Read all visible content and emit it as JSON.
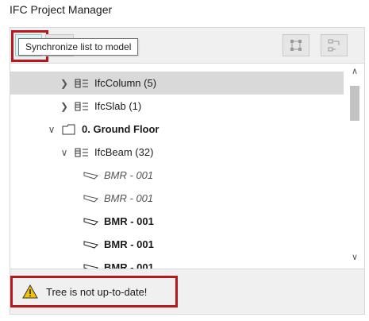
{
  "window": {
    "title": "IFC Project Manager"
  },
  "toolbar": {
    "sync_tooltip": "Synchronize list to model"
  },
  "tree": {
    "rows": [
      {
        "label": "IfcColumn (5)",
        "expand": ">",
        "icon": "ifc-entity-icon",
        "style": "normal"
      },
      {
        "label": "IfcSlab (1)",
        "expand": ">",
        "icon": "ifc-entity-icon",
        "style": "normal"
      },
      {
        "label": "0. Ground Floor",
        "expand": "v",
        "icon": "storey-icon",
        "style": "bold"
      },
      {
        "label": "IfcBeam (32)",
        "expand": "v",
        "icon": "ifc-entity-icon",
        "style": "normal"
      },
      {
        "label": "BMR - 001",
        "icon": "beam-icon",
        "style": "italic"
      },
      {
        "label": "BMR - 001",
        "icon": "beam-icon",
        "style": "italic"
      },
      {
        "label": "BMR - 001",
        "icon": "beam-icon",
        "style": "bold"
      },
      {
        "label": "BMR - 001",
        "icon": "beam-icon",
        "style": "bold"
      },
      {
        "label": "BMR - 001",
        "icon": "beam-icon",
        "style": "bold"
      }
    ]
  },
  "status": {
    "message": "Tree is not up-to-date!"
  },
  "colors": {
    "highlight": "#b7181f",
    "sync_icon": "#1aa79b",
    "warning": "#f2c200"
  }
}
